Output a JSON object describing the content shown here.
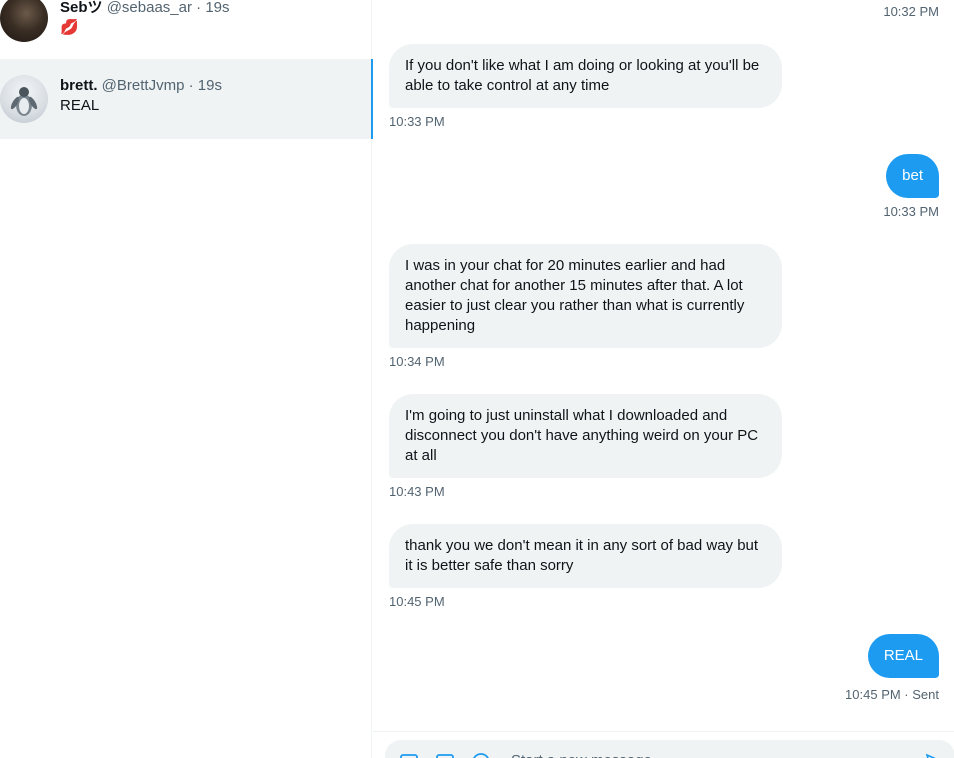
{
  "colors": {
    "accent": "#1d9bf0",
    "bubble_in": "#eff3f4",
    "muted": "#536471",
    "text": "#0f1419"
  },
  "conversations": [
    {
      "name": "Sebツ",
      "handle": "@sebaas_ar",
      "dot": "·",
      "time": "19s",
      "preview": "💋",
      "selected": false
    },
    {
      "name": "brett.",
      "handle": "@BrettJvmp",
      "dot": "·",
      "time": "19s",
      "preview": "REAL",
      "selected": true
    }
  ],
  "chat": {
    "top_timestamp": "10:32 PM",
    "messages": [
      {
        "dir": "in",
        "text": "If you don't like what I am doing or looking at you'll be able to take control at any time",
        "time": "10:33 PM"
      },
      {
        "dir": "out",
        "text": "bet",
        "time": "10:33 PM"
      },
      {
        "dir": "in",
        "text": "I was in your chat for 20 minutes earlier and had another chat for another 15 minutes after that. A lot easier to just clear you rather than what is currently happening",
        "time": "10:34 PM"
      },
      {
        "dir": "in",
        "text": "I'm going to just uninstall what I downloaded and disconnect you don't have anything weird on your PC at all",
        "time": "10:43 PM"
      },
      {
        "dir": "in",
        "text": "thank you we don't mean it in any sort of bad way but it is better safe than sorry",
        "time": "10:45 PM"
      },
      {
        "dir": "out",
        "text": "REAL",
        "time": "10:45 PM · Sent"
      }
    ]
  },
  "composer": {
    "placeholder": "Start a new message",
    "icons": [
      "image-icon",
      "gif-icon",
      "emoji-icon",
      "send-icon"
    ]
  }
}
